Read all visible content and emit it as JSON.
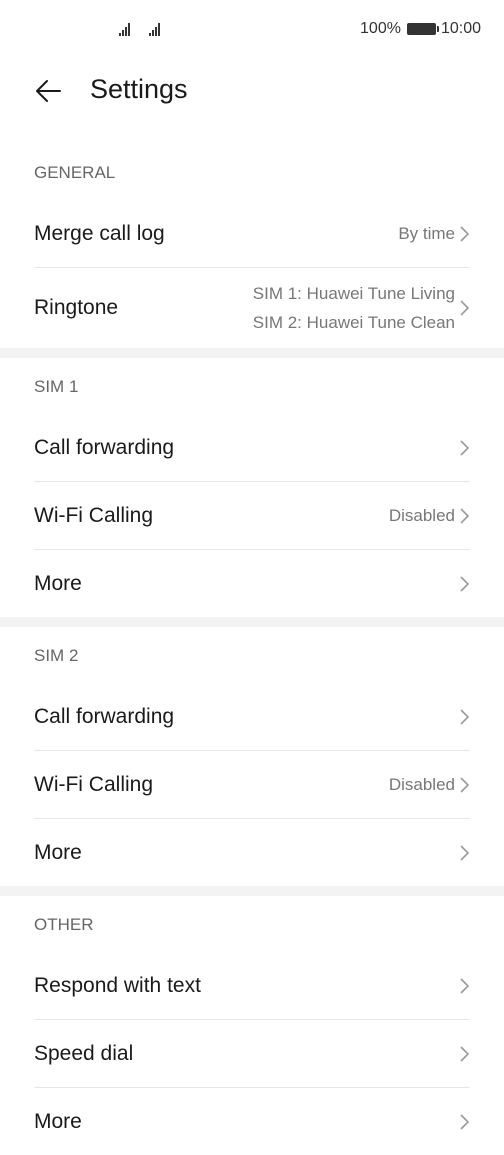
{
  "status_bar": {
    "battery_percent": "100%",
    "time": "10:00"
  },
  "header": {
    "title": "Settings"
  },
  "sections": [
    {
      "header": "GENERAL",
      "rows": [
        {
          "label": "Merge call log",
          "value": "By time"
        },
        {
          "label": "Ringtone",
          "value_lines": [
            "SIM 1: Huawei Tune Living",
            "SIM 2: Huawei Tune Clean"
          ]
        }
      ]
    },
    {
      "header": "SIM 1",
      "rows": [
        {
          "label": "Call forwarding"
        },
        {
          "label": "Wi-Fi Calling",
          "value": "Disabled"
        },
        {
          "label": "More"
        }
      ]
    },
    {
      "header": "SIM 2",
      "rows": [
        {
          "label": "Call forwarding"
        },
        {
          "label": "Wi-Fi Calling",
          "value": "Disabled"
        },
        {
          "label": "More"
        }
      ]
    },
    {
      "header": "OTHER",
      "rows": [
        {
          "label": "Respond with text"
        },
        {
          "label": "Speed dial"
        },
        {
          "label": "More"
        }
      ]
    }
  ]
}
